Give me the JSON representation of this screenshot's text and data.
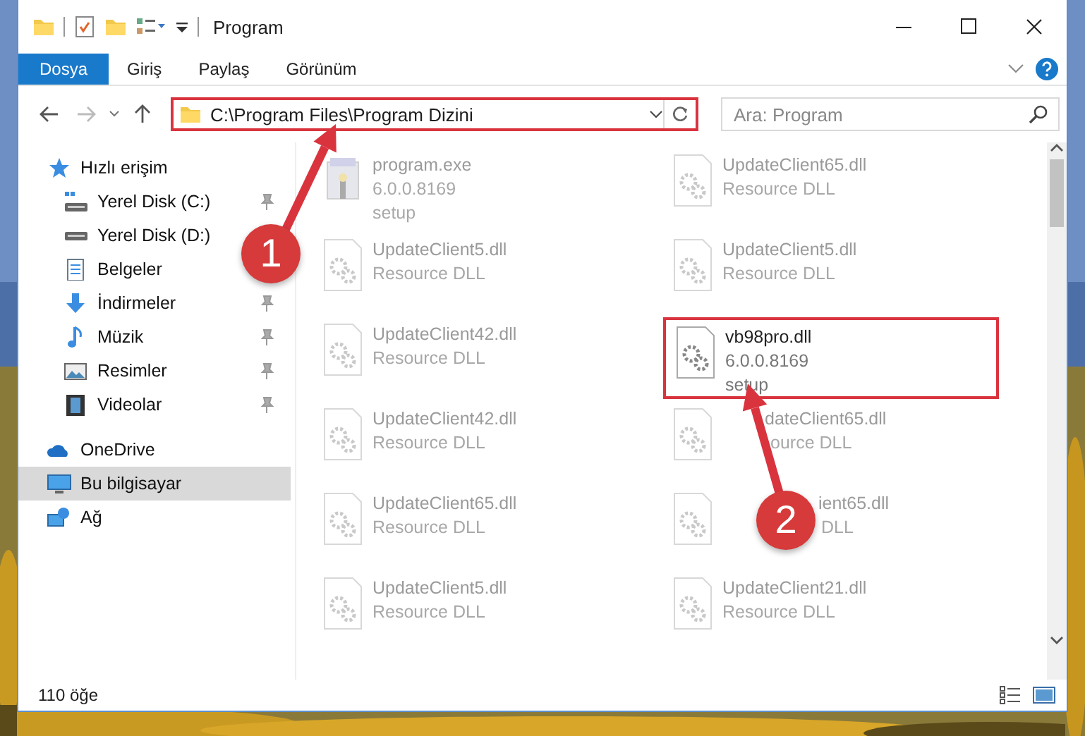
{
  "window": {
    "title": "Program"
  },
  "ribbon": {
    "tabs": [
      {
        "label": "Dosya",
        "selected": true
      },
      {
        "label": "Giriş",
        "selected": false
      },
      {
        "label": "Paylaş",
        "selected": false
      },
      {
        "label": "Görünüm",
        "selected": false
      }
    ]
  },
  "address_bar": {
    "path": "C:\\Program Files\\Program Dizini",
    "highlighted": true
  },
  "search": {
    "placeholder": "Ara: Program"
  },
  "sidebar": {
    "items": [
      {
        "label": "Hızlı erişim",
        "kind": "star",
        "selected": false,
        "children": [
          {
            "label": "Yerel Disk (C:)",
            "kind": "drive-c",
            "pinned": true
          },
          {
            "label": "Yerel Disk (D:)",
            "kind": "drive",
            "pinned": false
          },
          {
            "label": "Belgeler",
            "kind": "docs",
            "pinned": false
          },
          {
            "label": "İndirmeler",
            "kind": "download",
            "pinned": true
          },
          {
            "label": "Müzik",
            "kind": "music",
            "pinned": true
          },
          {
            "label": "Resimler",
            "kind": "pictures",
            "pinned": true
          },
          {
            "label": "Videolar",
            "kind": "videos",
            "pinned": true
          }
        ]
      },
      {
        "label": "OneDrive",
        "kind": "cloud",
        "selected": false
      },
      {
        "label": "Bu bilgisayar",
        "kind": "pc",
        "selected": true
      },
      {
        "label": "Ağ",
        "kind": "network",
        "selected": false
      }
    ]
  },
  "files": [
    {
      "kind": "exe",
      "name": "program.exe",
      "lines": [
        "6.0.0.8169",
        "setup"
      ],
      "dimmed": true,
      "highlighted": false
    },
    {
      "kind": "dll",
      "name": "UpdateClient65.dll",
      "lines": [
        "Resource DLL"
      ],
      "dimmed": true,
      "highlighted": false
    },
    {
      "kind": "dll",
      "name": "UpdateClient5.dll",
      "lines": [
        "Resource DLL"
      ],
      "dimmed": true,
      "highlighted": false
    },
    {
      "kind": "dll",
      "name": "UpdateClient5.dll",
      "lines": [
        "Resource DLL"
      ],
      "dimmed": true,
      "highlighted": false
    },
    {
      "kind": "dll",
      "name": "UpdateClient42.dll",
      "lines": [
        "Resource DLL"
      ],
      "dimmed": true,
      "highlighted": false
    },
    {
      "kind": "dll",
      "name": "vb98pro.dll",
      "lines": [
        "6.0.0.8169",
        "setup"
      ],
      "dimmed": false,
      "highlighted": true
    },
    {
      "kind": "dll",
      "name": "UpdateClient42.dll",
      "lines": [
        "Resource DLL"
      ],
      "dimmed": true,
      "highlighted": false
    },
    {
      "kind": "dll",
      "name": "dateClient65.dll",
      "lines": [
        "ource DLL"
      ],
      "dimmed": true,
      "highlighted": false
    },
    {
      "kind": "dll",
      "name": "UpdateClient65.dll",
      "lines": [
        "Resource DLL"
      ],
      "dimmed": true,
      "highlighted": false
    },
    {
      "kind": "dll",
      "name": "ient65.dll",
      "lines": [
        "DLL"
      ],
      "dimmed": true,
      "highlighted": false
    },
    {
      "kind": "dll",
      "name": "UpdateClient5.dll",
      "lines": [
        "Resource DLL"
      ],
      "dimmed": true,
      "highlighted": false
    },
    {
      "kind": "dll",
      "name": "UpdateClient21.dll",
      "lines": [
        "Resource DLL"
      ],
      "dimmed": true,
      "highlighted": false
    }
  ],
  "status_bar": {
    "count": "110 öğe"
  },
  "annotations": [
    {
      "number": "1"
    },
    {
      "number": "2"
    }
  ]
}
